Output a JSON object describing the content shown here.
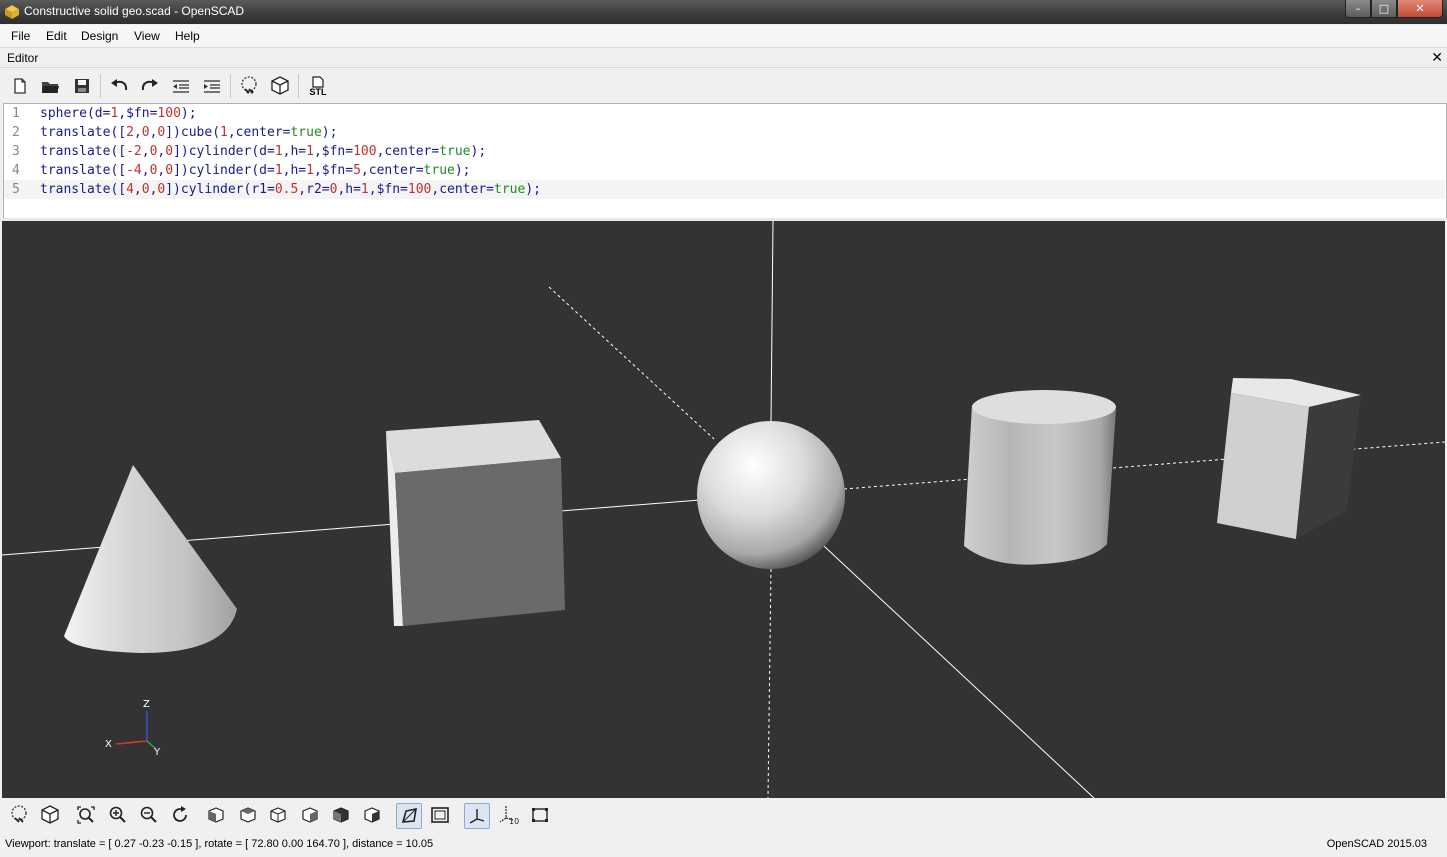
{
  "window": {
    "title": "Constructive solid geo.scad - OpenSCAD",
    "min_glyph": "–",
    "max_glyph": "□",
    "close_glyph": "✕"
  },
  "menu": [
    "File",
    "Edit",
    "Design",
    "View",
    "Help"
  ],
  "editor": {
    "label": "Editor",
    "close_glyph": "✕",
    "toolbar": [
      "new-file-icon",
      "open-file-icon",
      "save-icon",
      "undo-icon",
      "redo-icon",
      "unindent-icon",
      "indent-icon",
      "preview-icon",
      "render-icon",
      "export-stl-icon"
    ],
    "stl_label": "STL",
    "lines": [
      {
        "n": "1",
        "code": "sphere(d=1,$fn=100);"
      },
      {
        "n": "2",
        "code": "translate([2,0,0])cube(1,center=true);"
      },
      {
        "n": "3",
        "code": "translate([-2,0,0])cylinder(d=1,h=1,$fn=100,center=true);"
      },
      {
        "n": "4",
        "code": "translate([-4,0,0])cylinder(d=1,h=1,$fn=5,center=true);"
      },
      {
        "n": "5",
        "code": "translate([4,0,0])cylinder(r1=0.5,r2=0,h=1,$fn=100,center=true);"
      }
    ],
    "current_line": 5
  },
  "axes": {
    "x": "X",
    "y": "Y",
    "z": "Z"
  },
  "viewport_toolbar": [
    "preview-icon",
    "render-icon",
    "view-all-icon",
    "zoom-in-icon",
    "zoom-out-icon",
    "reset-view-icon",
    "view-right-icon",
    "view-top-icon",
    "view-bottom-icon",
    "view-left-icon",
    "view-front-icon",
    "view-back-icon",
    "perspective-icon",
    "orthogonal-icon",
    "show-axes-icon",
    "show-scale-markers-icon",
    "show-edges-icon"
  ],
  "scale_label": "10",
  "status": {
    "viewport": "Viewport: translate = [ 0.27 -0.23 -0.15 ], rotate = [ 72.80 0.00 164.70 ], distance = 10.05",
    "version": "OpenSCAD 2015.03"
  },
  "colors": {
    "viewport_bg": "#333333",
    "object": "#e8e8e8",
    "keyword": "#1a1a8c",
    "number": "#c03030",
    "bool": "#1f8a1f"
  }
}
